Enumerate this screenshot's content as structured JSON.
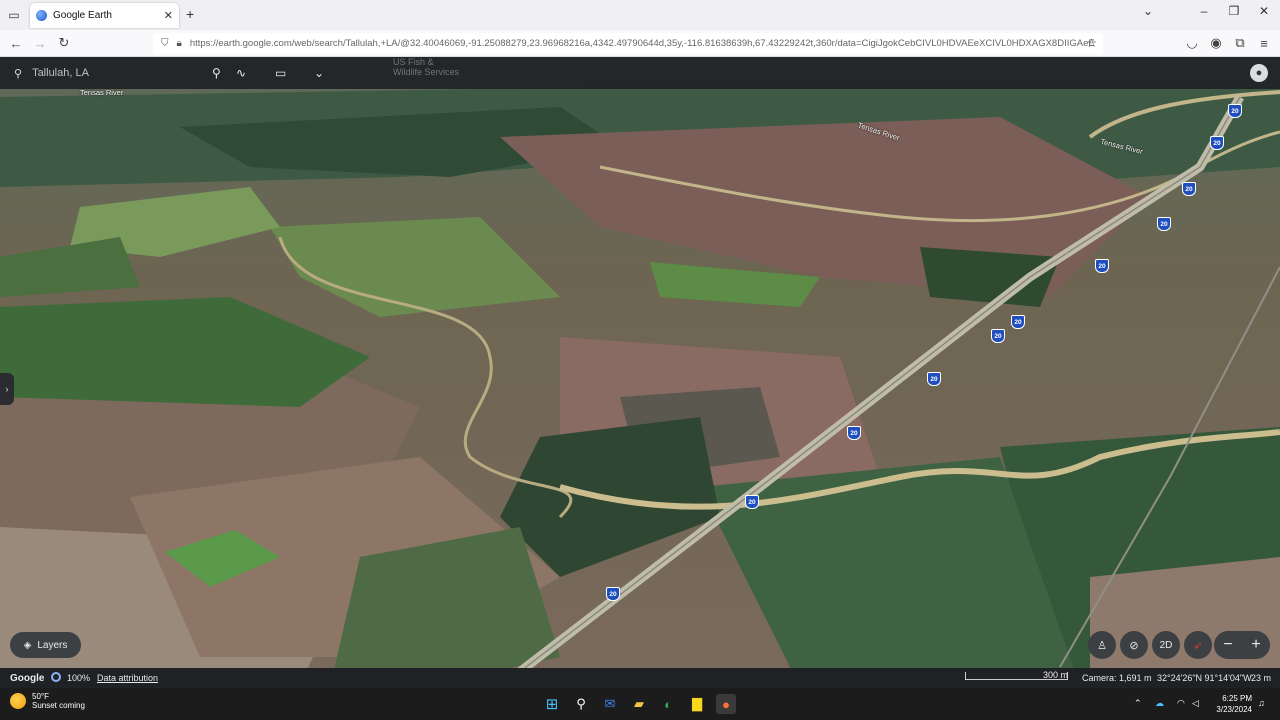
{
  "browser": {
    "tab_title": "Google Earth",
    "tab_close": "✕",
    "new_tab": "+",
    "url": "https://earth.google.com/web/search/Tallulah,+LA/@32.40046069,-91.25088279,23.96968216a,4342.49790644d,35y,-116.81638639h,67.43229242t,360r/data=CigiJgokCebCIVL0HDVAEeXCIVL0HDXAGX8DIIGAeE"
  },
  "earth": {
    "search_text": "Tallulah, LA",
    "overlay_label_line1": "US Fish &",
    "overlay_label_line2": "Wildlife Services",
    "river_labels": [
      "Tensas River",
      "Tensas River",
      "Tensas River"
    ],
    "interstate_number": "20",
    "layers_label": "Layers",
    "view_2d_label": "2D",
    "zoom_out": "−",
    "zoom_in": "+"
  },
  "status": {
    "brand": "Google",
    "load_percent": "100%",
    "attribution": "Data attribution",
    "scale_label": "300 m",
    "camera": "Camera: 1,691 m",
    "coords": "32°24'26\"N 91°14'04\"W",
    "elevation": "23 m"
  },
  "taskbar": {
    "temp": "50°F",
    "weather_desc": "Sunset coming",
    "time": "6:25 PM",
    "date": "3/23/2024"
  },
  "colors": {
    "interstate_shield": "#1f4fbf",
    "ui_dark": "#202124"
  }
}
